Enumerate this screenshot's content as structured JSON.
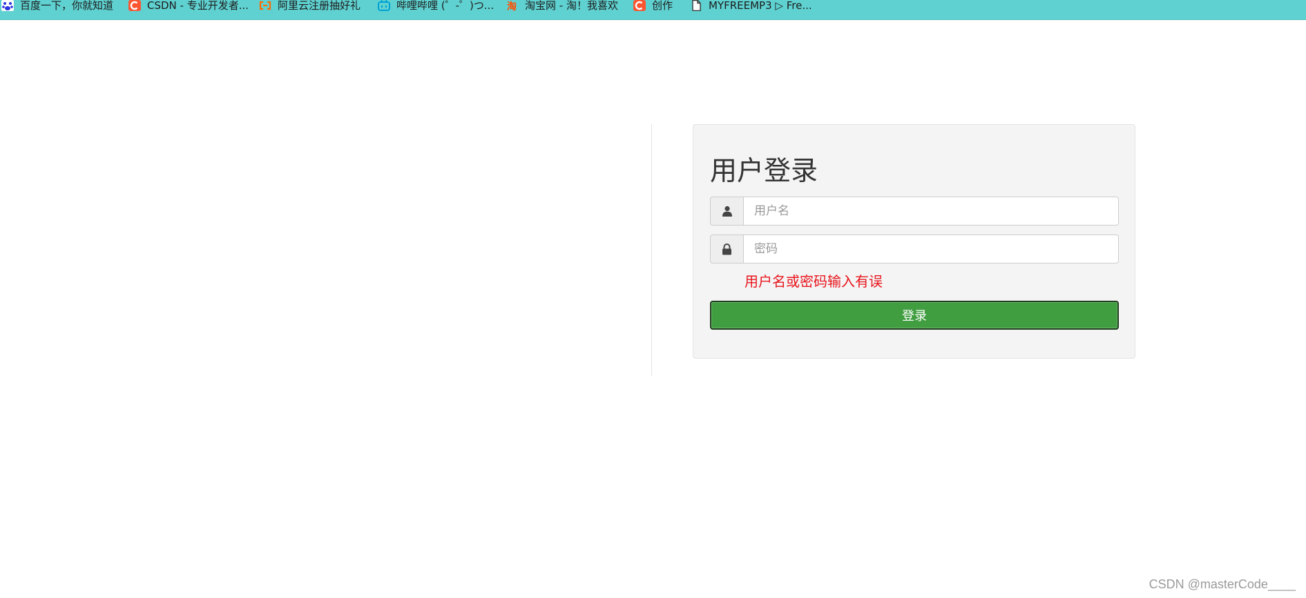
{
  "bookmarks": [
    {
      "label": "百度一下，你就知道",
      "icon": "baidu-paw-icon",
      "color": "#2932e1"
    },
    {
      "label": "CSDN - 专业开发者...",
      "icon": "csdn-logo-icon",
      "color": "#fc5531"
    },
    {
      "label": "阿里云注册抽好礼",
      "icon": "aliyun-logo-icon",
      "color": "#ff6a00"
    },
    {
      "label": "哔哩哔哩 (゜-゜)つ...",
      "icon": "bilibili-tv-icon",
      "color": "#00a1d6"
    },
    {
      "label": "淘宝网 - 淘！我喜欢",
      "icon": "taobao-logo-icon",
      "color": "#ff5000"
    },
    {
      "label": "创作",
      "icon": "csdn-logo-icon",
      "color": "#fc5531"
    },
    {
      "label": "MYFREEMP3 ▷ Fre...",
      "icon": "page-icon",
      "color": "#333333"
    }
  ],
  "login": {
    "title": "用户登录",
    "username_placeholder": "用户名",
    "username_value": "",
    "password_placeholder": "密码",
    "password_value": "",
    "error_message": "用户名或密码输入有误",
    "submit_label": "登录"
  },
  "colors": {
    "bookmarks_bar": "#5fd1d0",
    "panel_background": "#f4f4f4",
    "button_green": "#419e40",
    "error_red": "#e8141c"
  },
  "watermark": "CSDN @masterCode____"
}
